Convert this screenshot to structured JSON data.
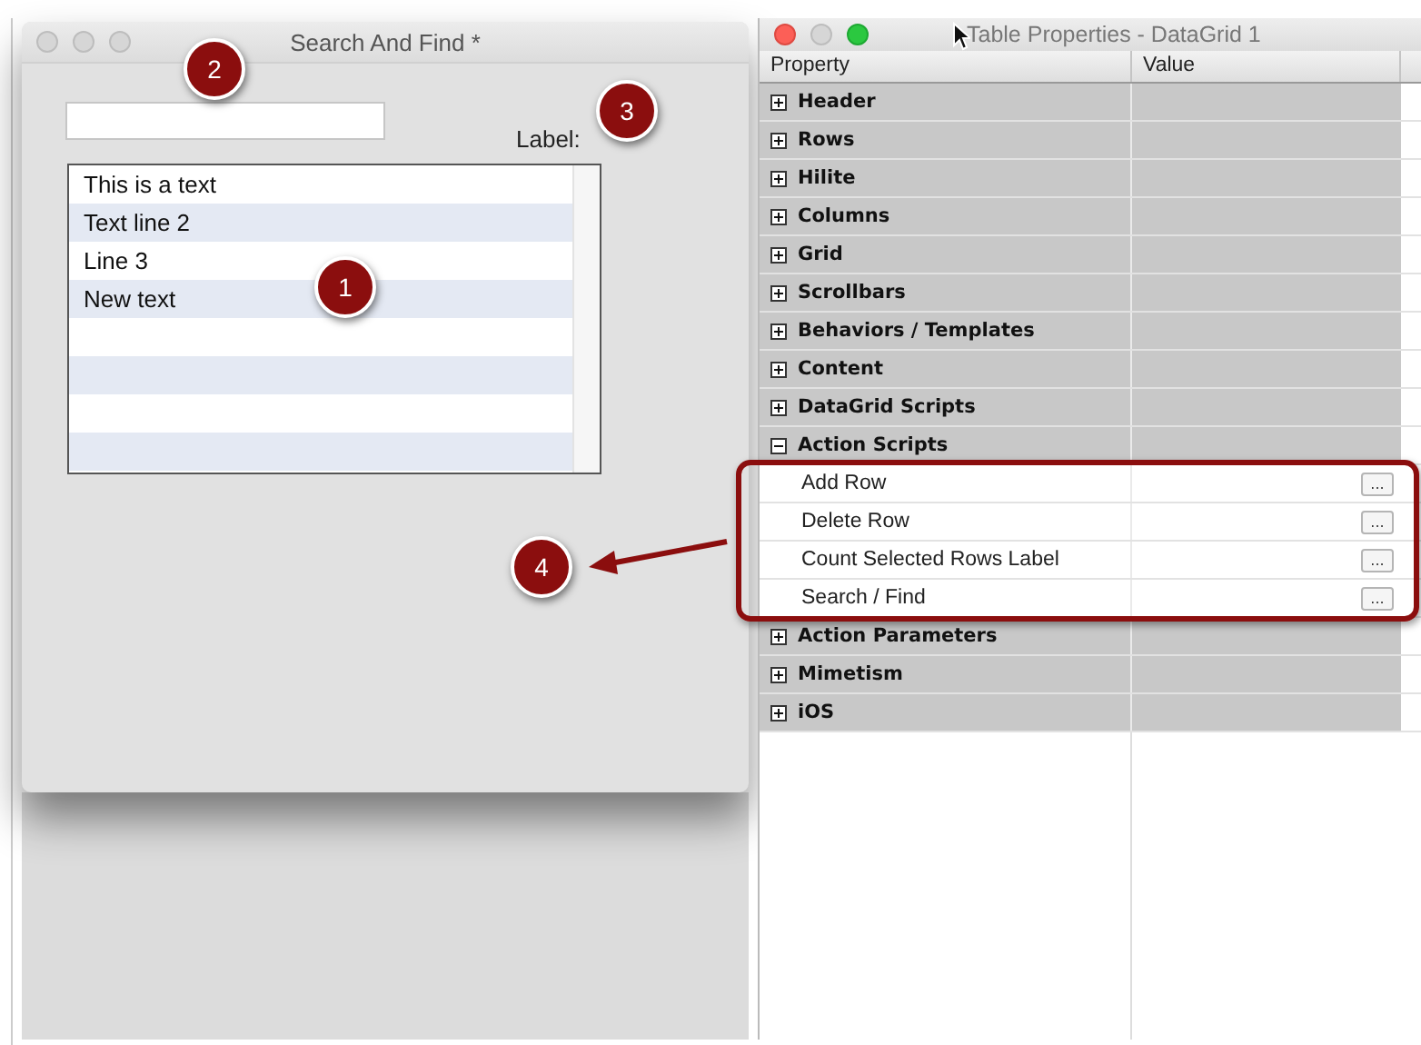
{
  "left_window": {
    "title": "Search And Find *",
    "label": "Label:",
    "list": {
      "items": [
        "This is a text",
        "Text line 2",
        "Line 3",
        "New text"
      ]
    }
  },
  "right_window": {
    "title": "Table Properties - DataGrid 1",
    "columns": [
      "Property",
      "Value"
    ],
    "properties": [
      {
        "label": "Header",
        "expanded": false
      },
      {
        "label": "Rows",
        "expanded": false
      },
      {
        "label": "Hilite",
        "expanded": false
      },
      {
        "label": "Columns",
        "expanded": false
      },
      {
        "label": "Grid",
        "expanded": false
      },
      {
        "label": "Scrollbars",
        "expanded": false
      },
      {
        "label": "Behaviors / Templates",
        "expanded": false
      },
      {
        "label": "Content",
        "expanded": false
      },
      {
        "label": "DataGrid Scripts",
        "expanded": false
      },
      {
        "label": "Action Scripts",
        "expanded": true,
        "children": [
          {
            "label": "Add Row",
            "button": "..."
          },
          {
            "label": "Delete Row",
            "button": "..."
          },
          {
            "label": "Count Selected Rows Label",
            "button": "..."
          },
          {
            "label": "Search / Find",
            "button": "..."
          }
        ]
      },
      {
        "label": "Action Parameters",
        "expanded": false
      },
      {
        "label": "Mimetism",
        "expanded": false
      },
      {
        "label": "iOS",
        "expanded": false
      }
    ]
  },
  "callouts": [
    "1",
    "2",
    "3",
    "4"
  ]
}
